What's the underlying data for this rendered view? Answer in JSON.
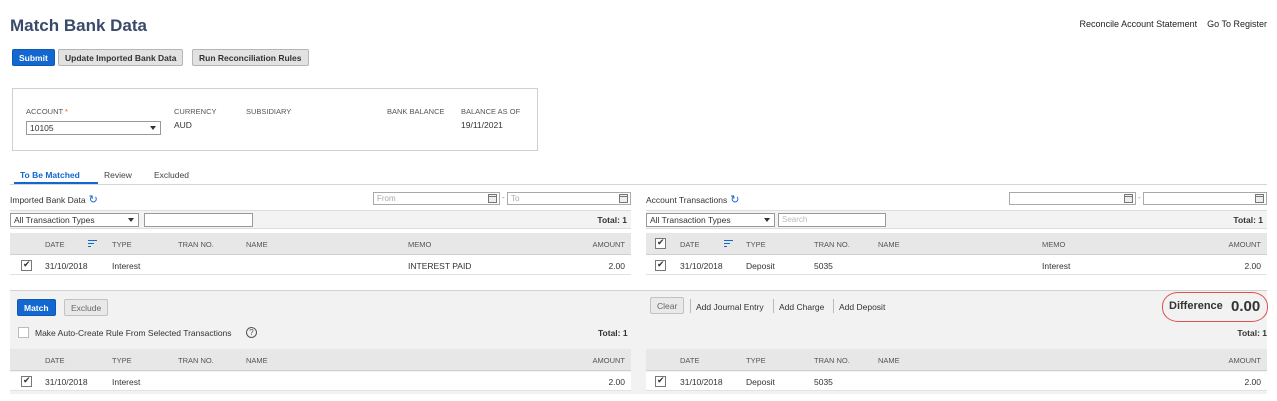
{
  "page": {
    "title": "Match Bank Data",
    "links": [
      "Reconcile Account Statement",
      "Go To Register"
    ]
  },
  "toolbar": {
    "submit": "Submit",
    "update": "Update Imported Bank Data",
    "run_rules": "Run Reconciliation Rules"
  },
  "account_box": {
    "account_label": "ACCOUNT",
    "required_mark": "*",
    "account_value": "10105",
    "currency_label": "CURRENCY",
    "currency_value": "AUD",
    "subsidiary_label": "SUBSIDIARY",
    "subsidiary_value": "",
    "bank_balance_label": "BANK BALANCE",
    "bank_balance_value": "",
    "balance_as_of_label": "BALANCE AS OF",
    "balance_as_of_value": "19/11/2021"
  },
  "tabs": [
    "To Be Matched",
    "Review",
    "Excluded"
  ],
  "imported": {
    "title": "Imported Bank Data",
    "from_placeholder": "From",
    "to_placeholder": "To",
    "type_filter": "All Transaction Types",
    "search_placeholder": "",
    "total": "Total: 1",
    "columns": [
      "DATE",
      "TYPE",
      "TRAN NO.",
      "NAME",
      "MEMO",
      "AMOUNT"
    ],
    "rows": [
      {
        "date": "31/10/2018",
        "type": "Interest",
        "tran_no": "",
        "name": "",
        "memo": "INTEREST PAID",
        "amount": "2.00",
        "checked": true
      }
    ]
  },
  "account_tx": {
    "title": "Account Transactions",
    "type_filter": "All Transaction Types",
    "search_placeholder": "Search",
    "total": "Total: 1",
    "columns": [
      "DATE",
      "TYPE",
      "TRAN NO.",
      "NAME",
      "MEMO",
      "AMOUNT"
    ],
    "rows": [
      {
        "date": "31/10/2018",
        "type": "Deposit",
        "tran_no": "5035",
        "name": "",
        "memo": "Interest",
        "amount": "2.00",
        "checked": true
      }
    ]
  },
  "match_panel": {
    "match": "Match",
    "exclude": "Exclude",
    "auto_rule": "Make Auto-Create Rule From Selected Transactions",
    "help": "?",
    "total_left": "Total: 1",
    "clear": "Clear",
    "add_journal": "Add Journal Entry",
    "add_charge": "Add Charge",
    "add_deposit": "Add Deposit",
    "difference_label": "Difference",
    "difference_value": "0.00",
    "total_right": "Total: 1",
    "left_columns": [
      "DATE",
      "TYPE",
      "TRAN NO.",
      "NAME",
      "AMOUNT"
    ],
    "left_rows": [
      {
        "date": "31/10/2018",
        "type": "Interest",
        "amount": "2.00",
        "checked": true
      }
    ],
    "right_columns": [
      "DATE",
      "TYPE",
      "TRAN NO.",
      "NAME",
      "AMOUNT"
    ],
    "right_rows": [
      {
        "date": "31/10/2018",
        "type": "Deposit",
        "tran_no": "5035",
        "amount": "2.00",
        "checked": true
      }
    ]
  },
  "colors": {
    "primary": "#1367d0",
    "title": "#3a4a6b",
    "difference_ring": "#e05050"
  }
}
